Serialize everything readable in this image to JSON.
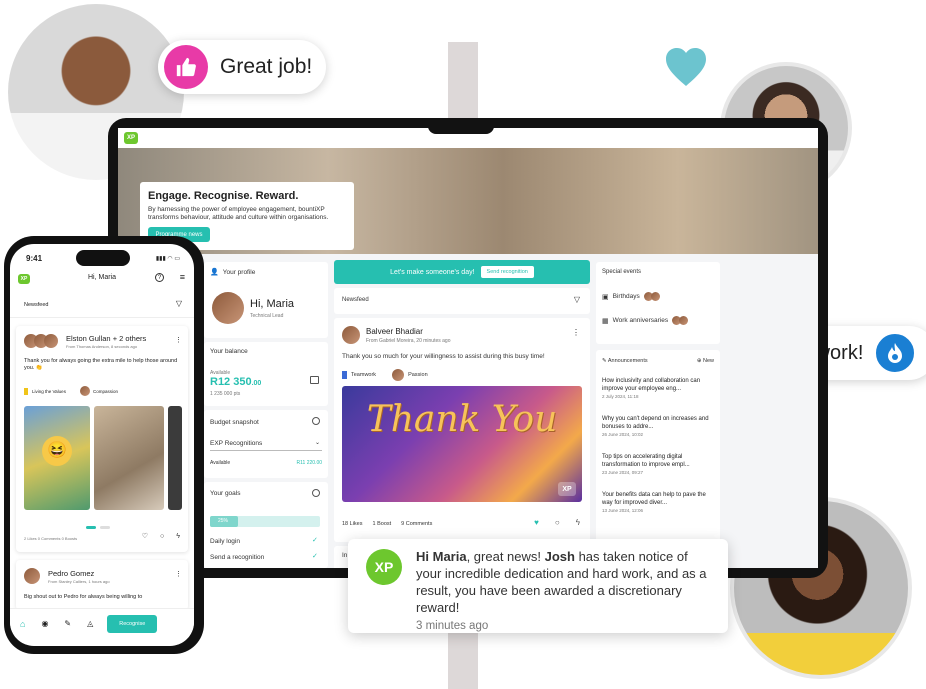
{
  "bubbles": {
    "great_job": "Great job!",
    "teamwork": "#teamwork!"
  },
  "colors": {
    "accent": "#26bfb0",
    "brand_green": "#6dc72e",
    "pink": "#e83aa7",
    "blue": "#1a7fd3"
  },
  "desktop": {
    "logo": "XP",
    "hero": {
      "title": "Engage. Recognise. Reward.",
      "body": "By harnessing the power of employee engagement, bountiXP transforms behaviour, attitude and culture within organisations.",
      "button": "Programme news"
    },
    "profile": {
      "label": "Your profile",
      "greeting": "Hi, Maria",
      "role": "Technical Lead"
    },
    "balance": {
      "label": "Your balance",
      "available_label": "Available",
      "amount": "R12 350",
      "cents": ".00",
      "points": "1 235 000 pts"
    },
    "budget": {
      "label": "Budget snapshot",
      "select": "EXP Recognitions",
      "available_label": "Available",
      "amount": "R11 220.00"
    },
    "goals": {
      "label": "Your goals",
      "progress_label": "25%",
      "progress": 0.25,
      "items": [
        "Daily login",
        "Send a recognition"
      ]
    },
    "cta": {
      "text": "Let's make someone's day!",
      "button": "Send recognition"
    },
    "newsfeed": {
      "label": "Newsfeed",
      "post": {
        "author": "Balveer Bhadiar",
        "meta": "From Gabriel Moreira, 20 minutes ago",
        "text": "Thank you so much for your willingness to assist during this busy time!",
        "tags": [
          "Teamwork",
          "Passion"
        ],
        "image_text": "Thank You",
        "likes": "18 Likes",
        "boost": "1 Boost",
        "comments": "9 Comments"
      },
      "next_post_peek": "In"
    },
    "special_events": {
      "label": "Special events",
      "items": [
        "Birthdays",
        "Work anniversaries"
      ]
    },
    "announcements": {
      "label": "Announcements",
      "new_button": "New",
      "items": [
        {
          "title": "How inclusivity and collaboration can improve your employee eng...",
          "date": "2 July 2024, 11:18"
        },
        {
          "title": "Why you can't depend on increases and bonuses to addre...",
          "date": "26 June 2024, 10:02"
        },
        {
          "title": "Top tips on accelerating digital transformation to improve empl...",
          "date": "23 June 2024, 09:27"
        },
        {
          "title": "Your benefits data can help to pave the way for improved diver...",
          "date": "13 June 2024, 12:06"
        }
      ]
    }
  },
  "phone": {
    "time": "9:41",
    "logo": "XP",
    "greeting": "Hi, Maria",
    "newsfeed_label": "Newsfeed",
    "post1": {
      "author": "Elston Gullan + 2 others",
      "meta": "From Thomas Anderson, 8 seconds ago",
      "text": "Thank you for always going the extra mile to help those around you. 👏",
      "tags": [
        "Living the Values",
        "Compassion"
      ],
      "stats": "2 Likes  0 Comments  0 Boosts"
    },
    "post2": {
      "author": "Pedro Gomez",
      "meta": "From Stanley Calliers, 1 hours ago",
      "text": "Big shout out to Pedro for always being willing to"
    },
    "nav": {
      "recognise": "Recognise"
    }
  },
  "notification": {
    "logo": "XP",
    "greeting": "Hi Maria",
    "part1": ", great news! ",
    "name": "Josh",
    "part2": " has taken notice of your incredible dedication and hard work, and as a result, you have been awarded a discretionary reward!",
    "time": "3 minutes ago"
  }
}
